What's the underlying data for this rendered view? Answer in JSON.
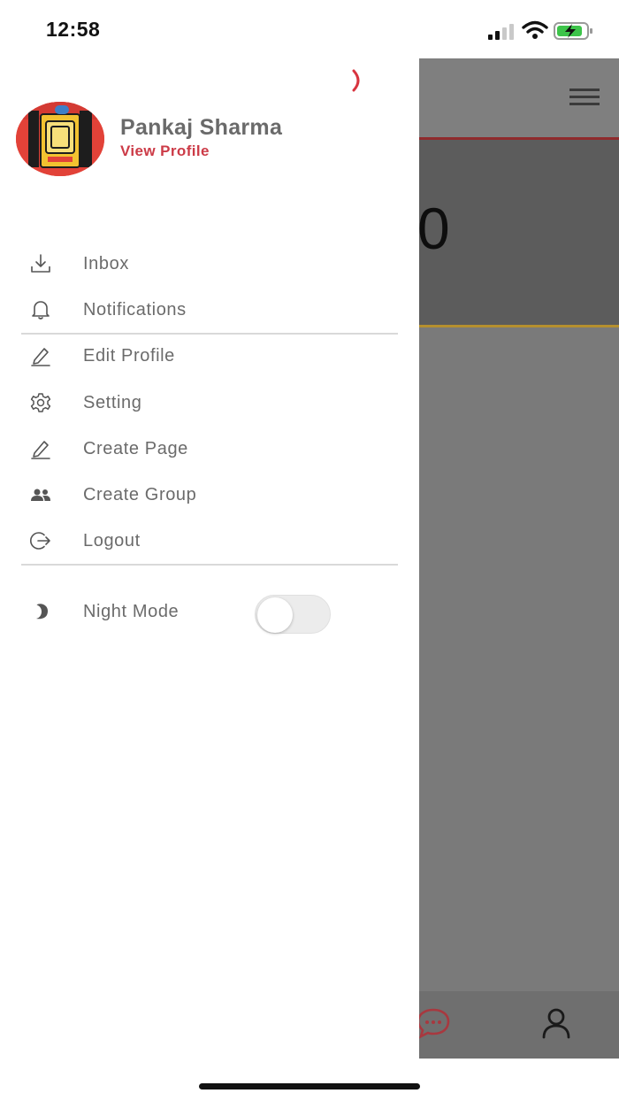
{
  "status_bar": {
    "time": "12:58",
    "icons": [
      "signal-icon",
      "wifi-icon",
      "battery-charging-icon"
    ]
  },
  "drawer": {
    "profile": {
      "name": "Pankaj Sharma",
      "view_profile_label": "View Profile"
    },
    "menu": [
      {
        "label": "Inbox",
        "icon": "download-icon"
      },
      {
        "label": "Notifications",
        "icon": "bell-icon"
      },
      {
        "label": "Edit Profile",
        "icon": "pencil-icon"
      },
      {
        "label": "Setting",
        "icon": "gear-icon"
      },
      {
        "label": "Create Page",
        "icon": "pencil-icon"
      },
      {
        "label": "Create Group",
        "icon": "group-icon"
      },
      {
        "label": "Logout",
        "icon": "logout-icon"
      }
    ],
    "night_mode": {
      "label": "Night Mode",
      "icon": "moon-icon",
      "enabled": false
    }
  },
  "background": {
    "big_text": "0",
    "icons": [
      "menu-icon",
      "chat-icon",
      "user-icon"
    ]
  },
  "colors": {
    "accent": "#cc3b47",
    "overlay": "#7b7b7b"
  }
}
